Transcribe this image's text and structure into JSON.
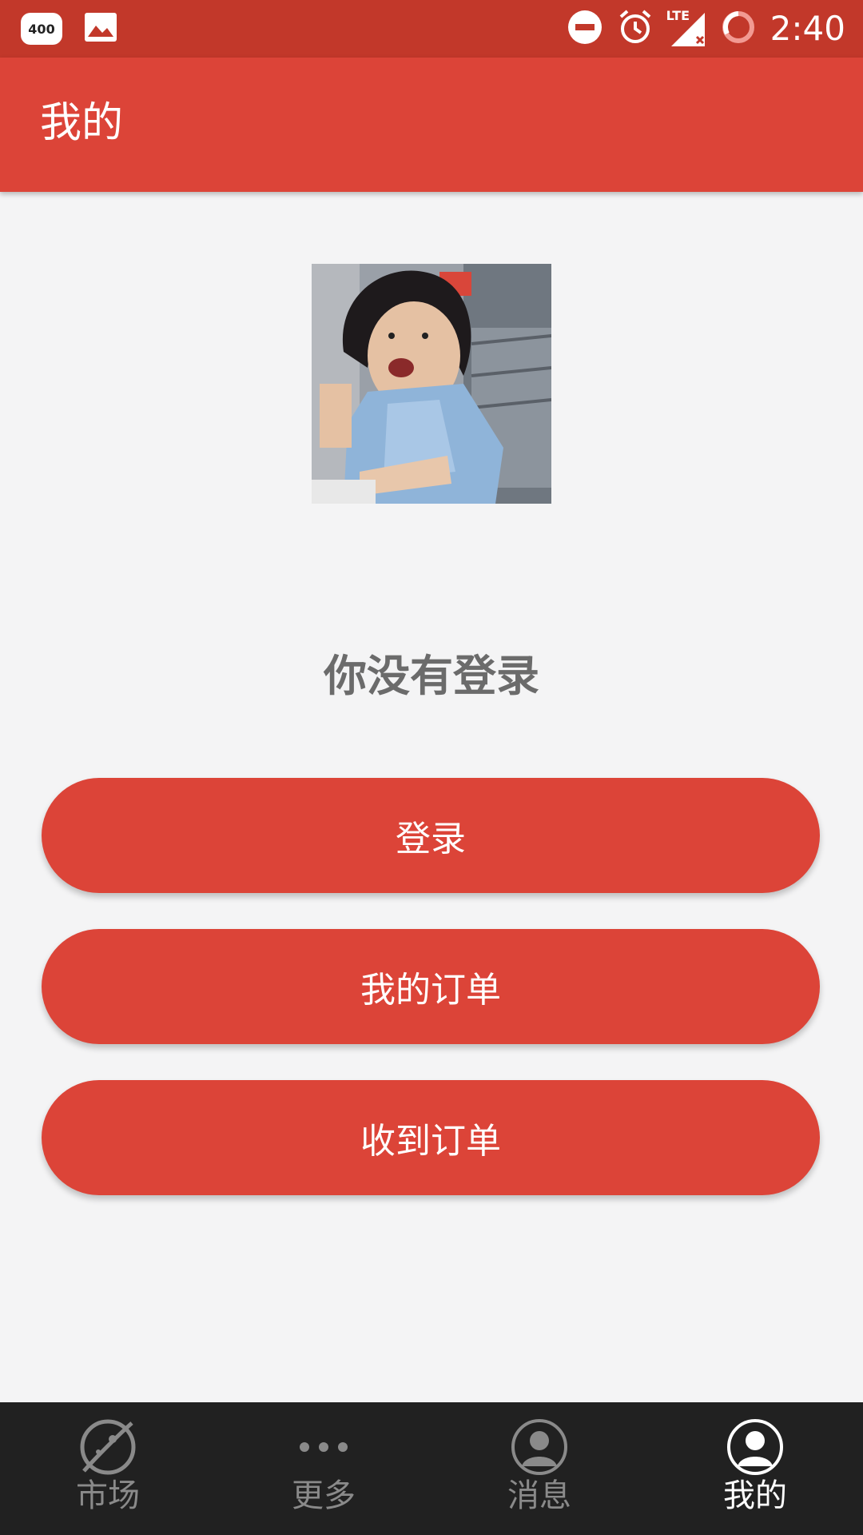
{
  "status_bar": {
    "badge_text": "400",
    "time": "2:40",
    "network_label": "LTE",
    "icons": [
      "notification-badge-icon",
      "image-icon",
      "do-not-disturb-icon",
      "alarm-icon",
      "signal-icon",
      "battery-icon"
    ]
  },
  "app_bar": {
    "title": "我的"
  },
  "profile": {
    "avatar": "avatar-photo",
    "login_status": "你没有登录"
  },
  "actions": {
    "login_label": "登录",
    "my_orders_label": "我的订单",
    "received_orders_label": "收到订单"
  },
  "bottom_nav": {
    "items": [
      {
        "label": "市场",
        "icon": "planet-icon",
        "active": false
      },
      {
        "label": "更多",
        "icon": "more-dots-icon",
        "active": false
      },
      {
        "label": "消息",
        "icon": "person-circle-icon",
        "active": false
      },
      {
        "label": "我的",
        "icon": "person-circle-icon",
        "active": true
      }
    ]
  },
  "colors": {
    "status_bar": "#c2382a",
    "primary": "#dc4438",
    "background": "#f4f4f5",
    "nav_background": "#212121",
    "nav_inactive": "#8a8a8a",
    "nav_active": "#ffffff",
    "muted_text": "#6b6b6b"
  }
}
